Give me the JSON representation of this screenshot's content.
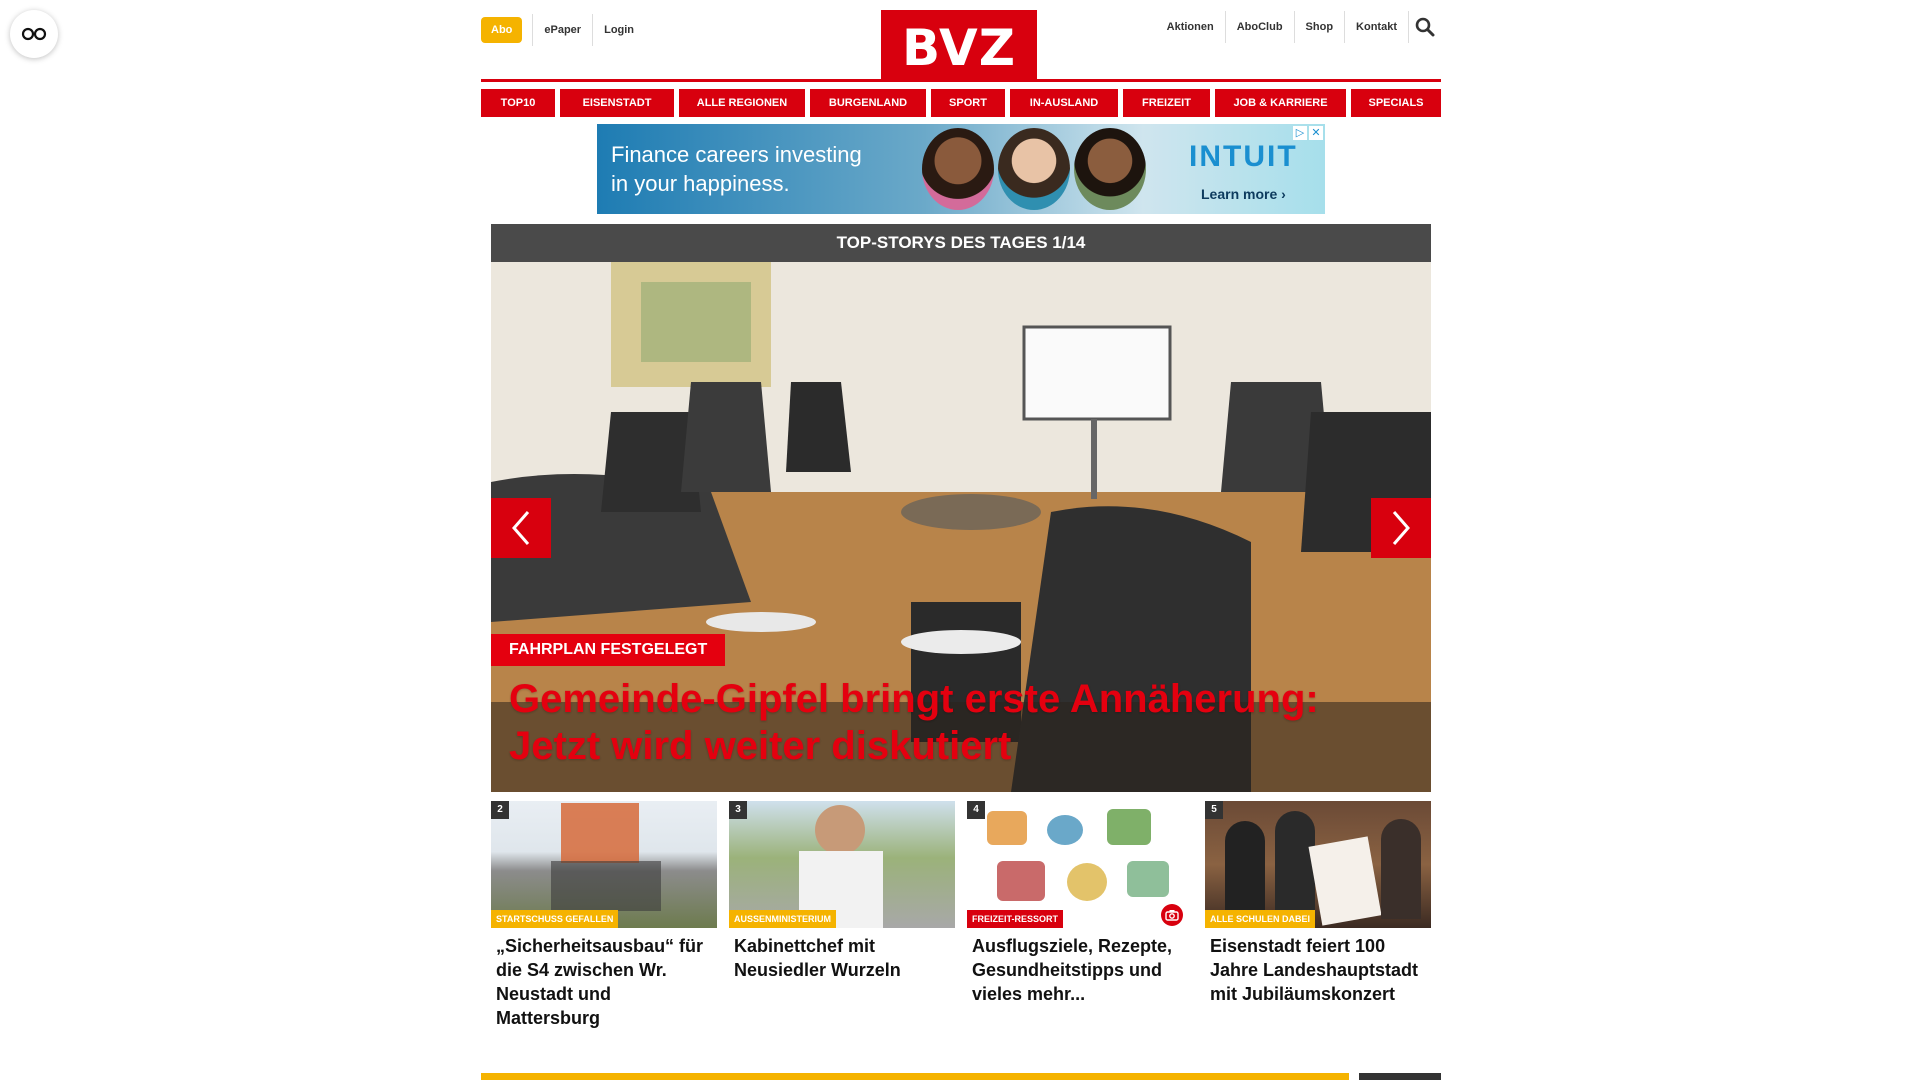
{
  "reader_icon": "glasses-icon",
  "header": {
    "abo_label": "Abo",
    "left_links": [
      "ePaper",
      "Login"
    ],
    "logo_text": "BVZ",
    "right_links": [
      "Aktionen",
      "AboClub",
      "Shop",
      "Kontakt"
    ],
    "search_icon": "search-icon",
    "brand_color": "#d8000e",
    "abo_color": "#f5b300"
  },
  "nav": {
    "items": [
      "TOP10",
      "EISENSTADT",
      "ALLE REGIONEN",
      "BURGENLAND",
      "SPORT",
      "IN-AUSLAND",
      "FREIZEIT",
      "JOB & KARRIERE",
      "SPECIALS"
    ]
  },
  "ad": {
    "headline_line1": "Finance careers investing",
    "headline_line2": "in your happiness.",
    "brand": "INTUIT",
    "cta": "Learn more ›",
    "choice_icons": [
      "ad-choices-icon",
      "close-icon"
    ]
  },
  "hero": {
    "section_title": "TOP-STORYS DES TAGES 1/14",
    "kicker": "FAHRPLAN FESTGELEGT",
    "title": "Gemeinde-Gipfel bringt erste Annäherung: Jetzt wird weiter diskutiert",
    "kicker_color": "#e4000f"
  },
  "teasers": [
    {
      "number": "2",
      "kicker": "STARTSCHUSS GEFALLEN",
      "kicker_color": "#f5b300",
      "title": "„Sicherheitsausbau“ für die S4 zwischen Wr. Neustadt und Mattersburg",
      "has_gallery": false
    },
    {
      "number": "3",
      "kicker": "AUSSENMINISTERIUM",
      "kicker_color": "#f5b300",
      "title": "Kabinettchef mit Neusiedler Wurzeln",
      "has_gallery": false
    },
    {
      "number": "4",
      "kicker": "FREIZEIT-RESSORT",
      "kicker_color": "#d8000e",
      "title": "Ausflugsziele, Rezepte, Gesundheitstipps und vieles mehr...",
      "has_gallery": true
    },
    {
      "number": "5",
      "kicker": "ALLE SCHULEN DABEI",
      "kicker_color": "#f5b300",
      "title": "Eisenstadt feiert 100 Jahre Landeshauptstadt mit Jubiläumskonzert",
      "has_gallery": false
    }
  ]
}
